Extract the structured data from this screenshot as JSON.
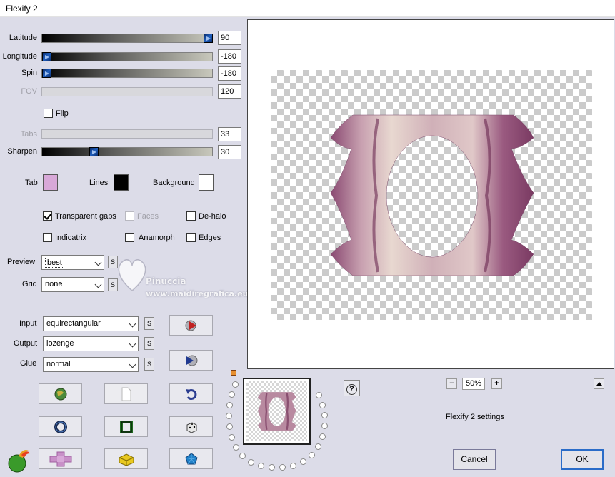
{
  "window": {
    "title": "Flexify 2"
  },
  "sliders": [
    {
      "id": "latitude",
      "label": "Latitude",
      "value": "90",
      "enabled": true,
      "level": 1.0
    },
    {
      "id": "longitude",
      "label": "Longitude",
      "value": "-180",
      "enabled": true,
      "level": 0.0
    },
    {
      "id": "spin",
      "label": "Spin",
      "value": "-180",
      "enabled": true,
      "level": 0.0
    },
    {
      "id": "fov",
      "label": "FOV",
      "value": "120",
      "enabled": false
    },
    {
      "id": "tabs",
      "label": "Tabs",
      "value": "33",
      "enabled": false
    },
    {
      "id": "sharpen",
      "label": "Sharpen",
      "value": "30",
      "enabled": true,
      "level": 0.3
    }
  ],
  "flip": {
    "label": "Flip",
    "checked": false
  },
  "colors": {
    "tab_label": "Tab",
    "tab_color": "#d8a8d8",
    "lines_label": "Lines",
    "lines_color": "#000000",
    "background_label": "Background",
    "background_color": "#ffffff"
  },
  "options": {
    "transparent_gaps": {
      "label": "Transparent gaps",
      "checked": true
    },
    "faces": {
      "label": "Faces",
      "checked": false,
      "enabled": false
    },
    "de_halo": {
      "label": "De-halo",
      "checked": false
    },
    "indicatrix": {
      "label": "Indicatrix",
      "checked": false
    },
    "anamorph": {
      "label": "Anamorph",
      "checked": false
    },
    "edges": {
      "label": "Edges",
      "checked": false
    }
  },
  "preview": {
    "label": "Preview",
    "value": "best"
  },
  "grid": {
    "label": "Grid",
    "value": "none"
  },
  "input": {
    "label": "Input",
    "value": "equirectangular"
  },
  "output": {
    "label": "Output",
    "value": "lozenge"
  },
  "glue": {
    "label": "Glue",
    "value": "normal"
  },
  "s_label": "S",
  "watermark": {
    "name": "Pinuccia",
    "url": "www.maidiregrafica.eu"
  },
  "zoom": {
    "value": "50%",
    "minus": "−",
    "plus": "+"
  },
  "settings_label": "Flexify 2 settings",
  "help_label": "?",
  "cancel_label": "Cancel",
  "ok_label": "OK",
  "accent_color": "#2a6cc8",
  "icons": [
    "render-forward-icon",
    "render-back-icon",
    "globe-icon",
    "new-page-icon",
    "undo-icon",
    "ring-icon",
    "square-frame-icon",
    "dice-icon",
    "logo-icon",
    "cross-shape-icon",
    "cube-icon",
    "pentagon-icon",
    "up-arrow-icon"
  ]
}
